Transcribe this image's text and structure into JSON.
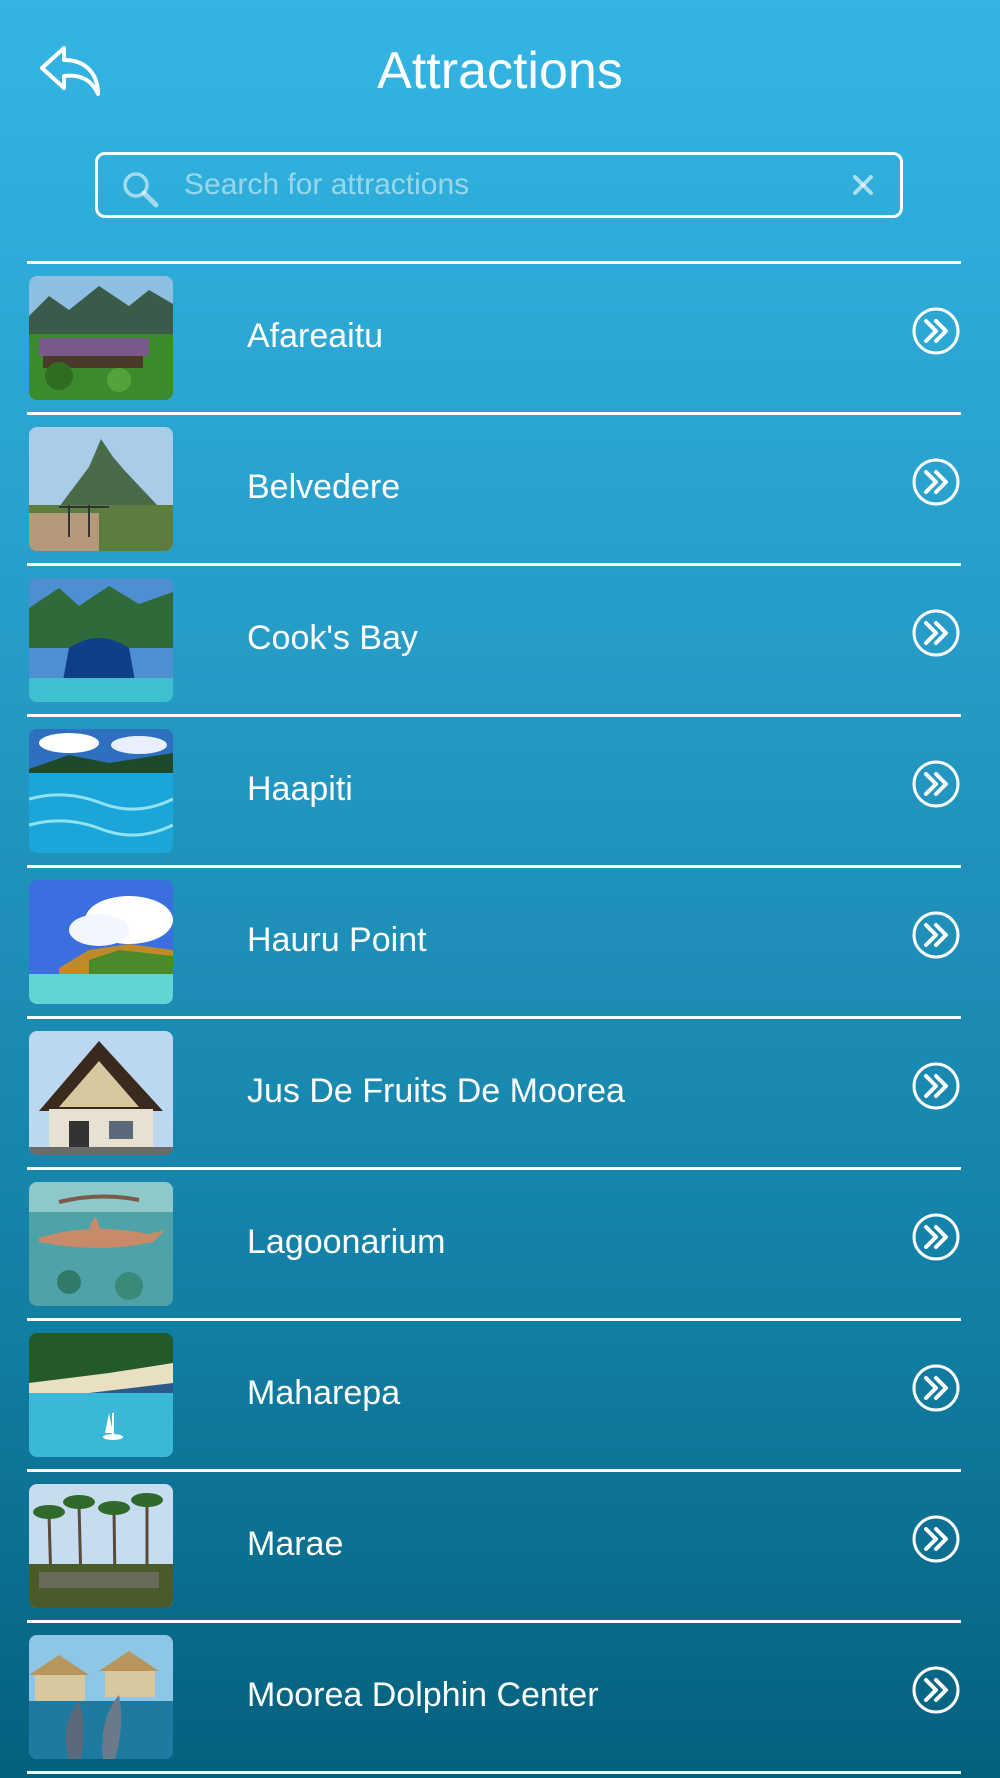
{
  "header": {
    "title": "Attractions",
    "back_icon": "back-reply-arrow-icon"
  },
  "search": {
    "placeholder": "Search for attractions",
    "value": "",
    "icon": "search-icon",
    "clear_icon": "clear-x-icon"
  },
  "attractions": [
    {
      "label": "Afareaitu",
      "thumb": "resort-lawn-mountains"
    },
    {
      "label": "Belvedere",
      "thumb": "mountain-lookout"
    },
    {
      "label": "Cook's Bay",
      "thumb": "bay-aerial"
    },
    {
      "label": "Haapiti",
      "thumb": "clear-water"
    },
    {
      "label": "Hauru Point",
      "thumb": "coast-clouds"
    },
    {
      "label": "Jus De Fruits De Moorea",
      "thumb": "a-frame-building"
    },
    {
      "label": "Lagoonarium",
      "thumb": "shark-underwater"
    },
    {
      "label": "Maharepa",
      "thumb": "lagoon-boats"
    },
    {
      "label": "Marae",
      "thumb": "palm-trees-ruins"
    },
    {
      "label": "Moorea Dolphin Center",
      "thumb": "dolphins-bungalows"
    }
  ],
  "colors": {
    "gradient_top": "#33b5e3",
    "gradient_bottom": "#05607d",
    "foreground": "#ffffff"
  }
}
